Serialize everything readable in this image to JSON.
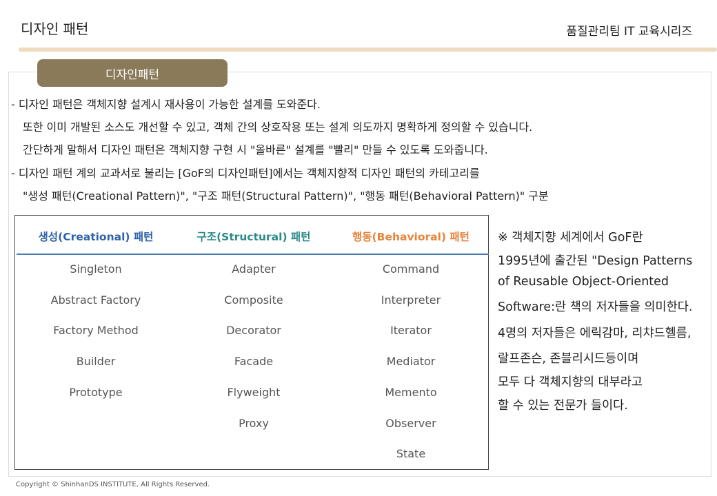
{
  "header": {
    "title": "디자인 패턴",
    "series": "품질관리팀 IT 교육시리즈"
  },
  "section_tab": "디자인패턴",
  "body_lines": [
    "- 디자인 패턴은 객체지향 설계시 재사용이 가능한 설계를 도와준다.",
    "또한 이미 개발된 소스도 개선할 수 있고, 객체 간의 상호작용 또는 설계 의도까지 명확하게 정의할 수 있습니다.",
    "간단하게 말해서 디자인 패턴은 객체지향 구현 시  \"올바른\" 설계를 \"빨리\" 만들 수 있도록 도와줍니다.",
    "- 디자인 패턴 계의 교과서로 불리는 [GoF의 디자인패턴]에서는 객체지향적 디자인 패턴의 카테고리를",
    "\"생성 패턴(Creational Pattern)\", \"구조 패턴(Structural Pattern)\", \"행동 패턴(Behavioral Pattern)\" 구분"
  ],
  "table": {
    "headers": [
      {
        "label": "생성(Creational) 패턴",
        "color": "#2e63a8"
      },
      {
        "label": "구조(Structural) 패턴",
        "color": "#2d8a8a"
      },
      {
        "label": "행동(Behavioral) 패턴",
        "color": "#e8833a"
      }
    ],
    "columns": [
      [
        "Singleton",
        "Abstract Factory",
        "Factory Method",
        "Builder",
        "Prototype"
      ],
      [
        "Adapter",
        "Composite",
        "Decorator",
        "Facade",
        "Flyweight",
        "Proxy"
      ],
      [
        "Command",
        "Interpreter",
        "Iterator",
        "Mediator",
        "Memento",
        "Observer",
        "State"
      ]
    ]
  },
  "note_lines": [
    "※ 객체지향 세계에서 GoF란",
    "1995년에 출간된 \"Design Patterns",
    "of Reusable Object-Oriented",
    "Software:란 책의 저자들을 의미한다.",
    "4명의 저자들은 에릭감마, 리챠드헬름,",
    "랄프존슨, 존블리시드등이며",
    "모두 다 객체지향의 대부라고",
    "할 수 있는 전문가 들이다."
  ],
  "copyright": "Copyright © ShinhanDS INSTITUTE, All Rights Reserved."
}
